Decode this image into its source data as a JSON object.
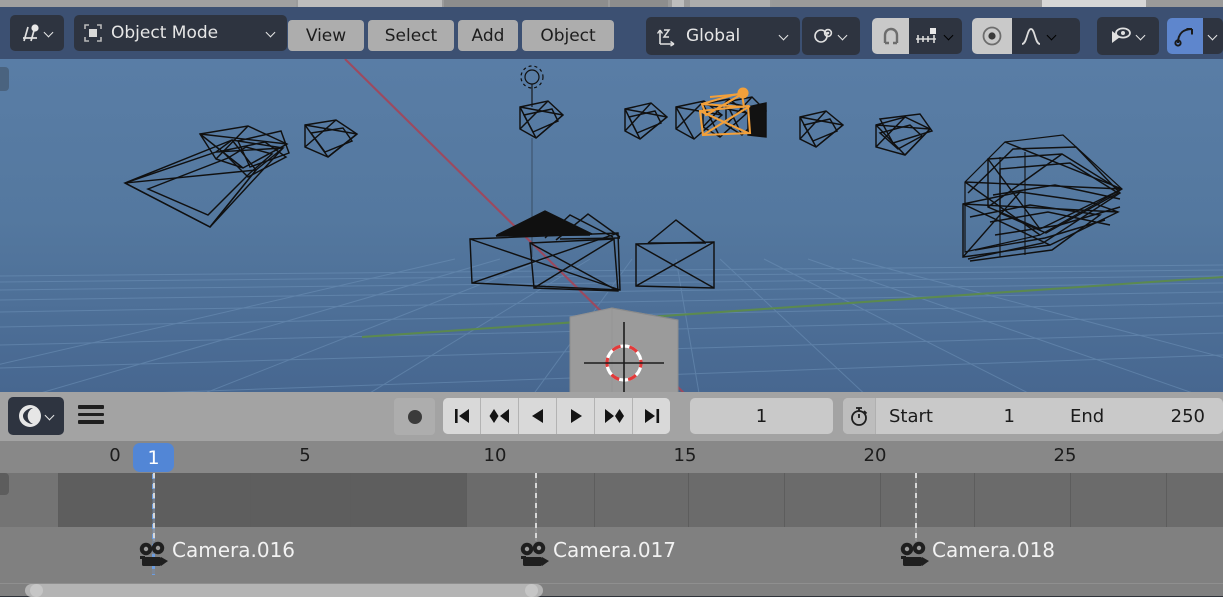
{
  "app": "Blender",
  "viewport_header": {
    "editor_type_icon": "editor-type-3d-viewport-icon",
    "mode": {
      "label": "Object Mode",
      "icon": "object-mode-icon",
      "chevron": "chevron-down-icon"
    },
    "menus": [
      "View",
      "Select",
      "Add",
      "Object"
    ],
    "transform_orientation": {
      "label": "Global",
      "icon": "orientation-axis-icon",
      "chevron": "chevron-down-icon"
    },
    "pivot": {
      "icon": "pivot-point-icon",
      "chevron": "chevron-down-icon"
    },
    "snap": {
      "magnet_icon": "magnet-icon",
      "magnet_active": true,
      "target_icon": "snap-increment-icon",
      "chevron": "chevron-down-icon"
    },
    "proportional": {
      "icon": "proportional-edit-icon",
      "active": true,
      "falloff_icon": "falloff-curve-icon",
      "chevron": "chevron-down-icon"
    },
    "visibility": {
      "icon": "object-visibility-icon",
      "chevron": "chevron-down-icon"
    },
    "gizmo": {
      "icon": "show-gizmo-icon",
      "active": true,
      "chevron": "chevron-down-icon"
    }
  },
  "viewport_scene": {
    "background_top": "#5b7fa8",
    "background_bottom": "#48698c",
    "grid_color": "#6d90b6",
    "axis_x_color": "#a84b5c",
    "axis_y_color": "#5f8a4a",
    "wire_color": "#121212",
    "selected_color": "#f5a33c",
    "cube_color": "#9a9a9a",
    "cursor_colors": [
      "#ffffff",
      "#e03030"
    ],
    "selected_object": "camera-rig-selected"
  },
  "timeline_header": {
    "editor_type_icon": "editor-type-timeline-icon",
    "editor_chevron": "chevron-down-icon",
    "menu_icon": "hamburger-menu-icon",
    "record_icon": "auto-keying-record-icon",
    "transport": [
      {
        "name": "jump-to-start-button",
        "icon": "jump-start-icon"
      },
      {
        "name": "jump-to-prev-keyframe-button",
        "icon": "prev-keyframe-icon"
      },
      {
        "name": "play-reverse-button",
        "icon": "play-reverse-icon"
      },
      {
        "name": "play-button",
        "icon": "play-icon"
      },
      {
        "name": "jump-to-next-keyframe-button",
        "icon": "next-keyframe-icon"
      },
      {
        "name": "jump-to-end-button",
        "icon": "jump-end-icon"
      }
    ],
    "current_frame": "1",
    "use_preview_range_icon": "stopwatch-icon",
    "start_label": "Start",
    "start_value": "1",
    "end_label": "End",
    "end_value": "250"
  },
  "timeline": {
    "ruler_ticks": [
      {
        "label": "0",
        "frame": 0
      },
      {
        "label": "5",
        "frame": 5
      },
      {
        "label": "10",
        "frame": 10
      },
      {
        "label": "15",
        "frame": 15
      },
      {
        "label": "20",
        "frame": 20
      },
      {
        "label": "25",
        "frame": 25
      }
    ],
    "playhead": {
      "frame": 1,
      "label": "1",
      "color": "#5286d6"
    },
    "markers": [
      {
        "label": "Camera.016",
        "frame": 1,
        "icon": "camera-marker-icon"
      },
      {
        "label": "Camera.017",
        "frame": 11,
        "icon": "camera-marker-icon"
      },
      {
        "label": "Camera.018",
        "frame": 21,
        "icon": "camera-marker-icon"
      }
    ],
    "scrollbar": {
      "left_pct": 2,
      "width_pct": 42
    }
  },
  "colors": {
    "header_blue": "#3c5072",
    "panel_grey": "#a3a3a3",
    "ruler_grey": "#888888",
    "rows_grey": "#6b6b6b",
    "button_grey": "#adadad",
    "dark_button": "#2e3440",
    "accent_blue": "#5286d6"
  }
}
